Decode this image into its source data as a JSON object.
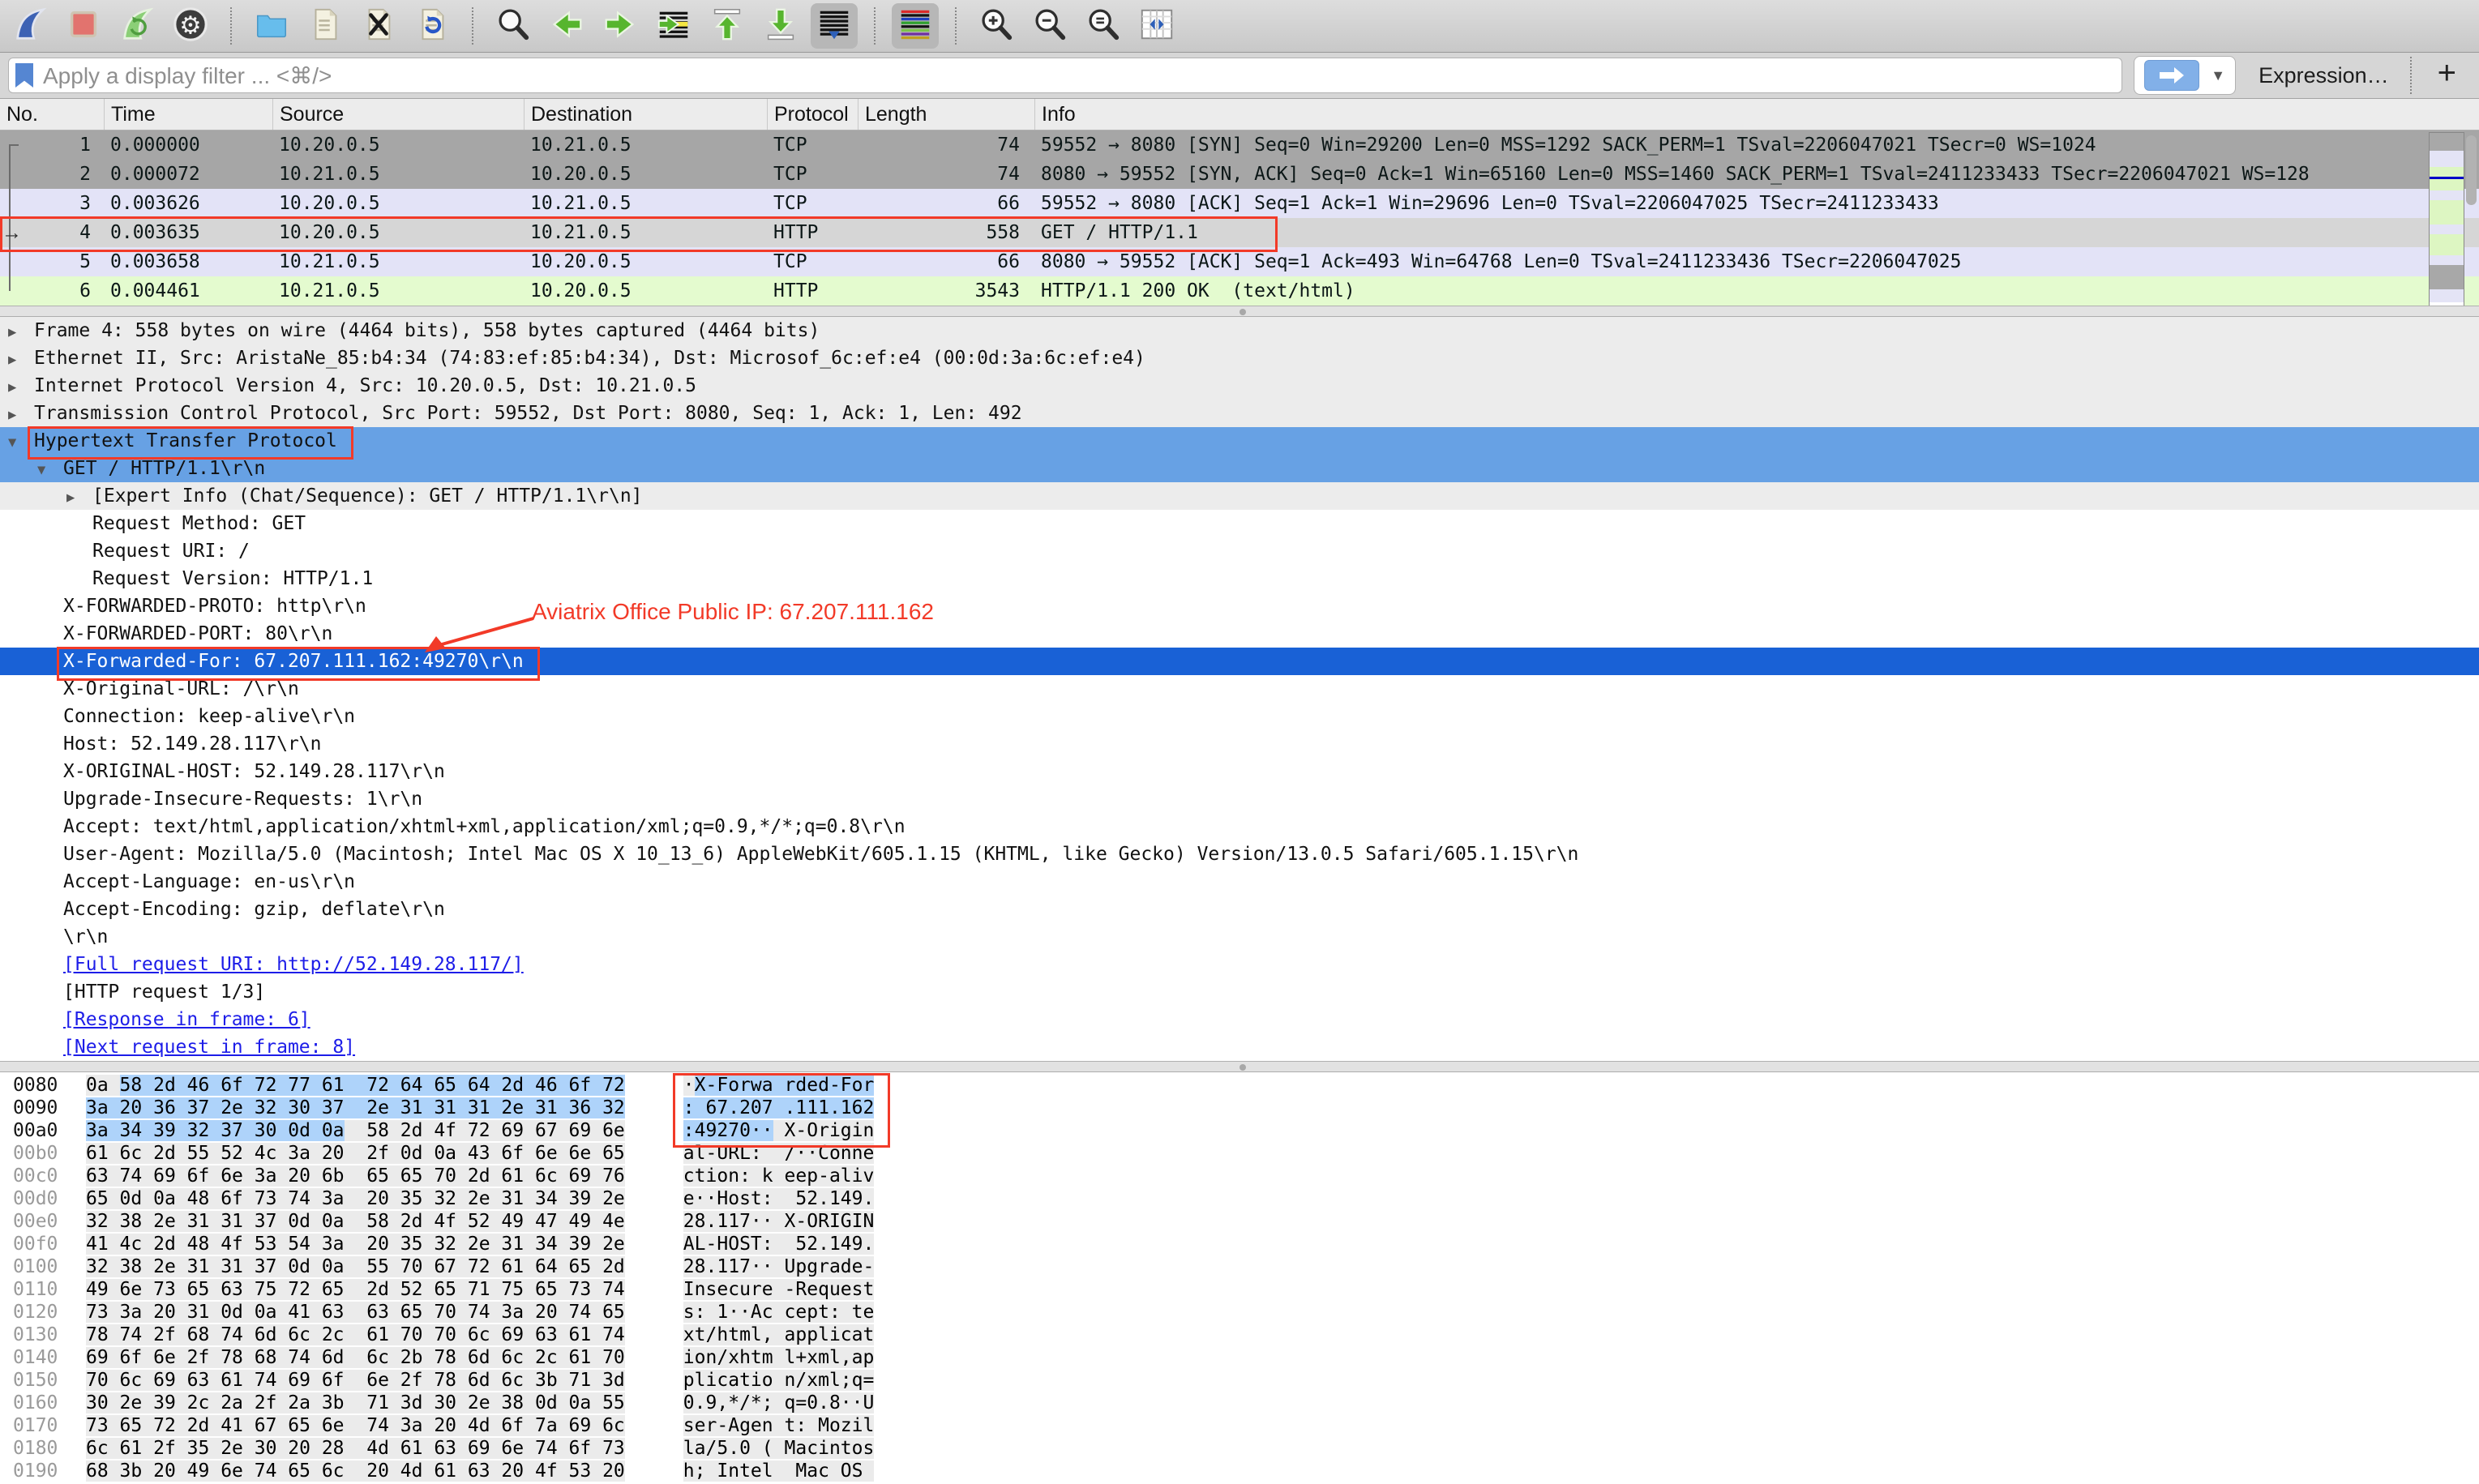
{
  "colors": {
    "row_grey": "#a6a6a6",
    "row_lavender": "#e3e3f7",
    "row_green": "#e4fbcf",
    "row_selected": "#d6d6d6",
    "selection_active": "#1961d6",
    "selection_inactive": "#67a1e4",
    "hex_highlight": "#aed3fa",
    "hex_band": "#ebebeb",
    "link_blue": "#1d1de8",
    "annotation_red": "#f23a28"
  },
  "toolbar": {
    "groups": [
      [
        "wireshark-start-capture",
        "stop-capture",
        "restart-capture",
        "capture-options"
      ],
      [
        "open-capture-file",
        "save-capture-file",
        "close-capture-file",
        "reload-capture-file"
      ],
      [
        "find-packet",
        "go-back",
        "go-forward",
        "go-to-packet",
        "go-first-packet",
        "go-last-packet",
        "auto-scroll-toggle"
      ],
      [
        "colorize-toggle"
      ],
      [
        "zoom-in",
        "zoom-out",
        "zoom-original",
        "resize-columns"
      ]
    ],
    "active": [
      "auto-scroll-toggle",
      "colorize-toggle"
    ]
  },
  "filter": {
    "placeholder": "Apply a display filter ... <⌘/>",
    "expression_label": "Expression…",
    "add_label": "+"
  },
  "packet_list": {
    "columns": [
      "No.",
      "Time",
      "Source",
      "Destination",
      "Protocol",
      "Length",
      "Info"
    ],
    "rows": [
      {
        "no": "1",
        "time": "0.000000",
        "src": "10.20.0.5",
        "dst": "10.21.0.5",
        "proto": "TCP",
        "len": "74",
        "info": "59552 → 8080 [SYN] Seq=0 Win=29200 Len=0 MSS=1292 SACK_PERM=1 TSval=2206047021 TSecr=0 WS=1024",
        "color": "grey"
      },
      {
        "no": "2",
        "time": "0.000072",
        "src": "10.21.0.5",
        "dst": "10.20.0.5",
        "proto": "TCP",
        "len": "74",
        "info": "8080 → 59552 [SYN, ACK] Seq=0 Ack=1 Win=65160 Len=0 MSS=1460 SACK_PERM=1 TSval=2411233433 TSecr=2206047021 WS=128",
        "color": "grey"
      },
      {
        "no": "3",
        "time": "0.003626",
        "src": "10.20.0.5",
        "dst": "10.21.0.5",
        "proto": "TCP",
        "len": "66",
        "info": "59552 → 8080 [ACK] Seq=1 Ack=1 Win=29696 Len=0 TSval=2206047025 TSecr=2411233433",
        "color": "lavender"
      },
      {
        "no": "4",
        "time": "0.003635",
        "src": "10.20.0.5",
        "dst": "10.21.0.5",
        "proto": "HTTP",
        "len": "558",
        "info": "GET / HTTP/1.1",
        "color": "selected",
        "current": true,
        "redbox": true
      },
      {
        "no": "5",
        "time": "0.003658",
        "src": "10.21.0.5",
        "dst": "10.20.0.5",
        "proto": "TCP",
        "len": "66",
        "info": "8080 → 59552 [ACK] Seq=1 Ack=493 Win=64768 Len=0 TSval=2411233436 TSecr=2206047025",
        "color": "lavender"
      },
      {
        "no": "6",
        "time": "0.004461",
        "src": "10.21.0.5",
        "dst": "10.20.0.5",
        "proto": "HTTP",
        "len": "3543",
        "info": "HTTP/1.1 200 OK  (text/html)",
        "color": "green"
      }
    ],
    "current_marker": "→",
    "minimap_bands": [
      {
        "c": "#a8a8a8",
        "h": 22
      },
      {
        "c": "#e4e4f6",
        "h": 20
      },
      {
        "c": "#ddf6c2",
        "h": 12
      },
      {
        "c": "#0000c8",
        "h": 3
      },
      {
        "c": "#ddf6c2",
        "h": 14
      },
      {
        "c": "#e4e4f6",
        "h": 12
      },
      {
        "c": "#ddf6c2",
        "h": 30
      },
      {
        "c": "#e4e4f6",
        "h": 12
      },
      {
        "c": "#ddf6c2",
        "h": 26
      },
      {
        "c": "#e4e4f6",
        "h": 12
      },
      {
        "c": "#a8a8a8",
        "h": 30
      },
      {
        "c": "#e4e4f6",
        "h": 16
      },
      {
        "c": "#ffffff",
        "h": 10
      }
    ]
  },
  "details": {
    "rows": [
      {
        "i": 0,
        "c": "r",
        "t": "Frame 4: 558 bytes on wire (4464 bits), 558 bytes captured (4464 bits)",
        "s": "band"
      },
      {
        "i": 0,
        "c": "r",
        "t": "Ethernet II, Src: AristaNe_85:b4:34 (74:83:ef:85:b4:34), Dst: Microsof_6c:ef:e4 (00:0d:3a:6c:ef:e4)",
        "s": "band"
      },
      {
        "i": 0,
        "c": "r",
        "t": "Internet Protocol Version 4, Src: 10.20.0.5, Dst: 10.21.0.5",
        "s": "band"
      },
      {
        "i": 0,
        "c": "r",
        "t": "Transmission Control Protocol, Src Port: 59552, Dst Port: 8080, Seq: 1, Ack: 1, Len: 492",
        "s": "band"
      },
      {
        "i": 0,
        "c": "d",
        "t": "Hypertext Transfer Protocol",
        "s": "sel1"
      },
      {
        "i": 1,
        "c": "d",
        "t": "GET / HTTP/1.1\\r\\n",
        "s": "sel1"
      },
      {
        "i": 2,
        "c": "r",
        "t": "[Expert Info (Chat/Sequence): GET / HTTP/1.1\\r\\n]",
        "s": "band"
      },
      {
        "i": 2,
        "c": "",
        "t": "Request Method: GET",
        "s": ""
      },
      {
        "i": 2,
        "c": "",
        "t": "Request URI: /",
        "s": ""
      },
      {
        "i": 2,
        "c": "",
        "t": "Request Version: HTTP/1.1",
        "s": ""
      },
      {
        "i": 1,
        "c": "",
        "t": "X-FORWARDED-PROTO: http\\r\\n",
        "s": ""
      },
      {
        "i": 1,
        "c": "",
        "t": "X-FORWARDED-PORT: 80\\r\\n",
        "s": ""
      },
      {
        "i": 1,
        "c": "",
        "t": "X-Forwarded-For: 67.207.111.162:49270\\r\\n",
        "s": "sel2"
      },
      {
        "i": 1,
        "c": "",
        "t": "X-Original-URL: /\\r\\n",
        "s": ""
      },
      {
        "i": 1,
        "c": "",
        "t": "Connection: keep-alive\\r\\n",
        "s": ""
      },
      {
        "i": 1,
        "c": "",
        "t": "Host: 52.149.28.117\\r\\n",
        "s": ""
      },
      {
        "i": 1,
        "c": "",
        "t": "X-ORIGINAL-HOST: 52.149.28.117\\r\\n",
        "s": ""
      },
      {
        "i": 1,
        "c": "",
        "t": "Upgrade-Insecure-Requests: 1\\r\\n",
        "s": ""
      },
      {
        "i": 1,
        "c": "",
        "t": "Accept: text/html,application/xhtml+xml,application/xml;q=0.9,*/*;q=0.8\\r\\n",
        "s": ""
      },
      {
        "i": 1,
        "c": "",
        "t": "User-Agent: Mozilla/5.0 (Macintosh; Intel Mac OS X 10_13_6) AppleWebKit/605.1.15 (KHTML, like Gecko) Version/13.0.5 Safari/605.1.15\\r\\n",
        "s": ""
      },
      {
        "i": 1,
        "c": "",
        "t": "Accept-Language: en-us\\r\\n",
        "s": ""
      },
      {
        "i": 1,
        "c": "",
        "t": "Accept-Encoding: gzip, deflate\\r\\n",
        "s": ""
      },
      {
        "i": 1,
        "c": "",
        "t": "\\r\\n",
        "s": ""
      },
      {
        "i": 1,
        "c": "",
        "t": "[Full request URI: http://52.149.28.117/]",
        "s": "link"
      },
      {
        "i": 1,
        "c": "",
        "t": "[HTTP request 1/3]",
        "s": ""
      },
      {
        "i": 1,
        "c": "",
        "t": "[Response in frame: 6]",
        "s": "link"
      },
      {
        "i": 1,
        "c": "",
        "t": "[Next request in frame: 8]",
        "s": "link"
      }
    ]
  },
  "annotations": {
    "note_text": "Aviatrix Office Public IP: 67.207.111.162"
  },
  "hex": {
    "rows": [
      {
        "off": "0080",
        "bytes": "0a 58 2d 46 6f 72 77 61 72 64 65 64 2d 46 6f 72",
        "ascii": "·X-Forwarded-For",
        "hl": [
          1,
          16
        ],
        "dim": false
      },
      {
        "off": "0090",
        "bytes": "3a 20 36 37 2e 32 30 37 2e 31 31 31 2e 31 36 32",
        "ascii": ": 67.207.111.162",
        "hl": [
          0,
          16
        ],
        "dim": false
      },
      {
        "off": "00a0",
        "bytes": "3a 34 39 32 37 30 0d 0a 58 2d 4f 72 69 67 69 6e",
        "ascii": ":49270··X-Origin",
        "hl": [
          0,
          8
        ],
        "dim": false
      },
      {
        "off": "00b0",
        "bytes": "61 6c 2d 55 52 4c 3a 20 2f 0d 0a 43 6f 6e 6e 65",
        "ascii": "al-URL: /··Conne",
        "hl": null,
        "dim": true
      },
      {
        "off": "00c0",
        "bytes": "63 74 69 6f 6e 3a 20 6b 65 65 70 2d 61 6c 69 76",
        "ascii": "ction: keep-aliv",
        "hl": null,
        "dim": true
      },
      {
        "off": "00d0",
        "bytes": "65 0d 0a 48 6f 73 74 3a 20 35 32 2e 31 34 39 2e",
        "ascii": "e··Host: 52.149.",
        "hl": null,
        "dim": true
      },
      {
        "off": "00e0",
        "bytes": "32 38 2e 31 31 37 0d 0a 58 2d 4f 52 49 47 49 4e",
        "ascii": "28.117··X-ORIGIN",
        "hl": null,
        "dim": true
      },
      {
        "off": "00f0",
        "bytes": "41 4c 2d 48 4f 53 54 3a 20 35 32 2e 31 34 39 2e",
        "ascii": "AL-HOST: 52.149.",
        "hl": null,
        "dim": true
      },
      {
        "off": "0100",
        "bytes": "32 38 2e 31 31 37 0d 0a 55 70 67 72 61 64 65 2d",
        "ascii": "28.117··Upgrade-",
        "hl": null,
        "dim": true
      },
      {
        "off": "0110",
        "bytes": "49 6e 73 65 63 75 72 65 2d 52 65 71 75 65 73 74",
        "ascii": "Insecure-Request",
        "hl": null,
        "dim": true
      },
      {
        "off": "0120",
        "bytes": "73 3a 20 31 0d 0a 41 63 63 65 70 74 3a 20 74 65",
        "ascii": "s: 1··Accept: te",
        "hl": null,
        "dim": true
      },
      {
        "off": "0130",
        "bytes": "78 74 2f 68 74 6d 6c 2c 61 70 70 6c 69 63 61 74",
        "ascii": "xt/html,applicat",
        "hl": null,
        "dim": true
      },
      {
        "off": "0140",
        "bytes": "69 6f 6e 2f 78 68 74 6d 6c 2b 78 6d 6c 2c 61 70",
        "ascii": "ion/xhtml+xml,ap",
        "hl": null,
        "dim": true
      },
      {
        "off": "0150",
        "bytes": "70 6c 69 63 61 74 69 6f 6e 2f 78 6d 6c 3b 71 3d",
        "ascii": "plication/xml;q=",
        "hl": null,
        "dim": true
      },
      {
        "off": "0160",
        "bytes": "30 2e 39 2c 2a 2f 2a 3b 71 3d 30 2e 38 0d 0a 55",
        "ascii": "0.9,*/*;q=0.8··U",
        "hl": null,
        "dim": true
      },
      {
        "off": "0170",
        "bytes": "73 65 72 2d 41 67 65 6e 74 3a 20 4d 6f 7a 69 6c",
        "ascii": "ser-Agent: Mozil",
        "hl": null,
        "dim": true
      },
      {
        "off": "0180",
        "bytes": "6c 61 2f 35 2e 30 20 28 4d 61 63 69 6e 74 6f 73",
        "ascii": "la/5.0 (Macintos",
        "hl": null,
        "dim": true
      },
      {
        "off": "0190",
        "bytes": "68 3b 20 49 6e 74 65 6c 20 4d 61 63 20 4f 53 20",
        "ascii": "h; Intel Mac OS ",
        "hl": null,
        "dim": true
      }
    ]
  }
}
